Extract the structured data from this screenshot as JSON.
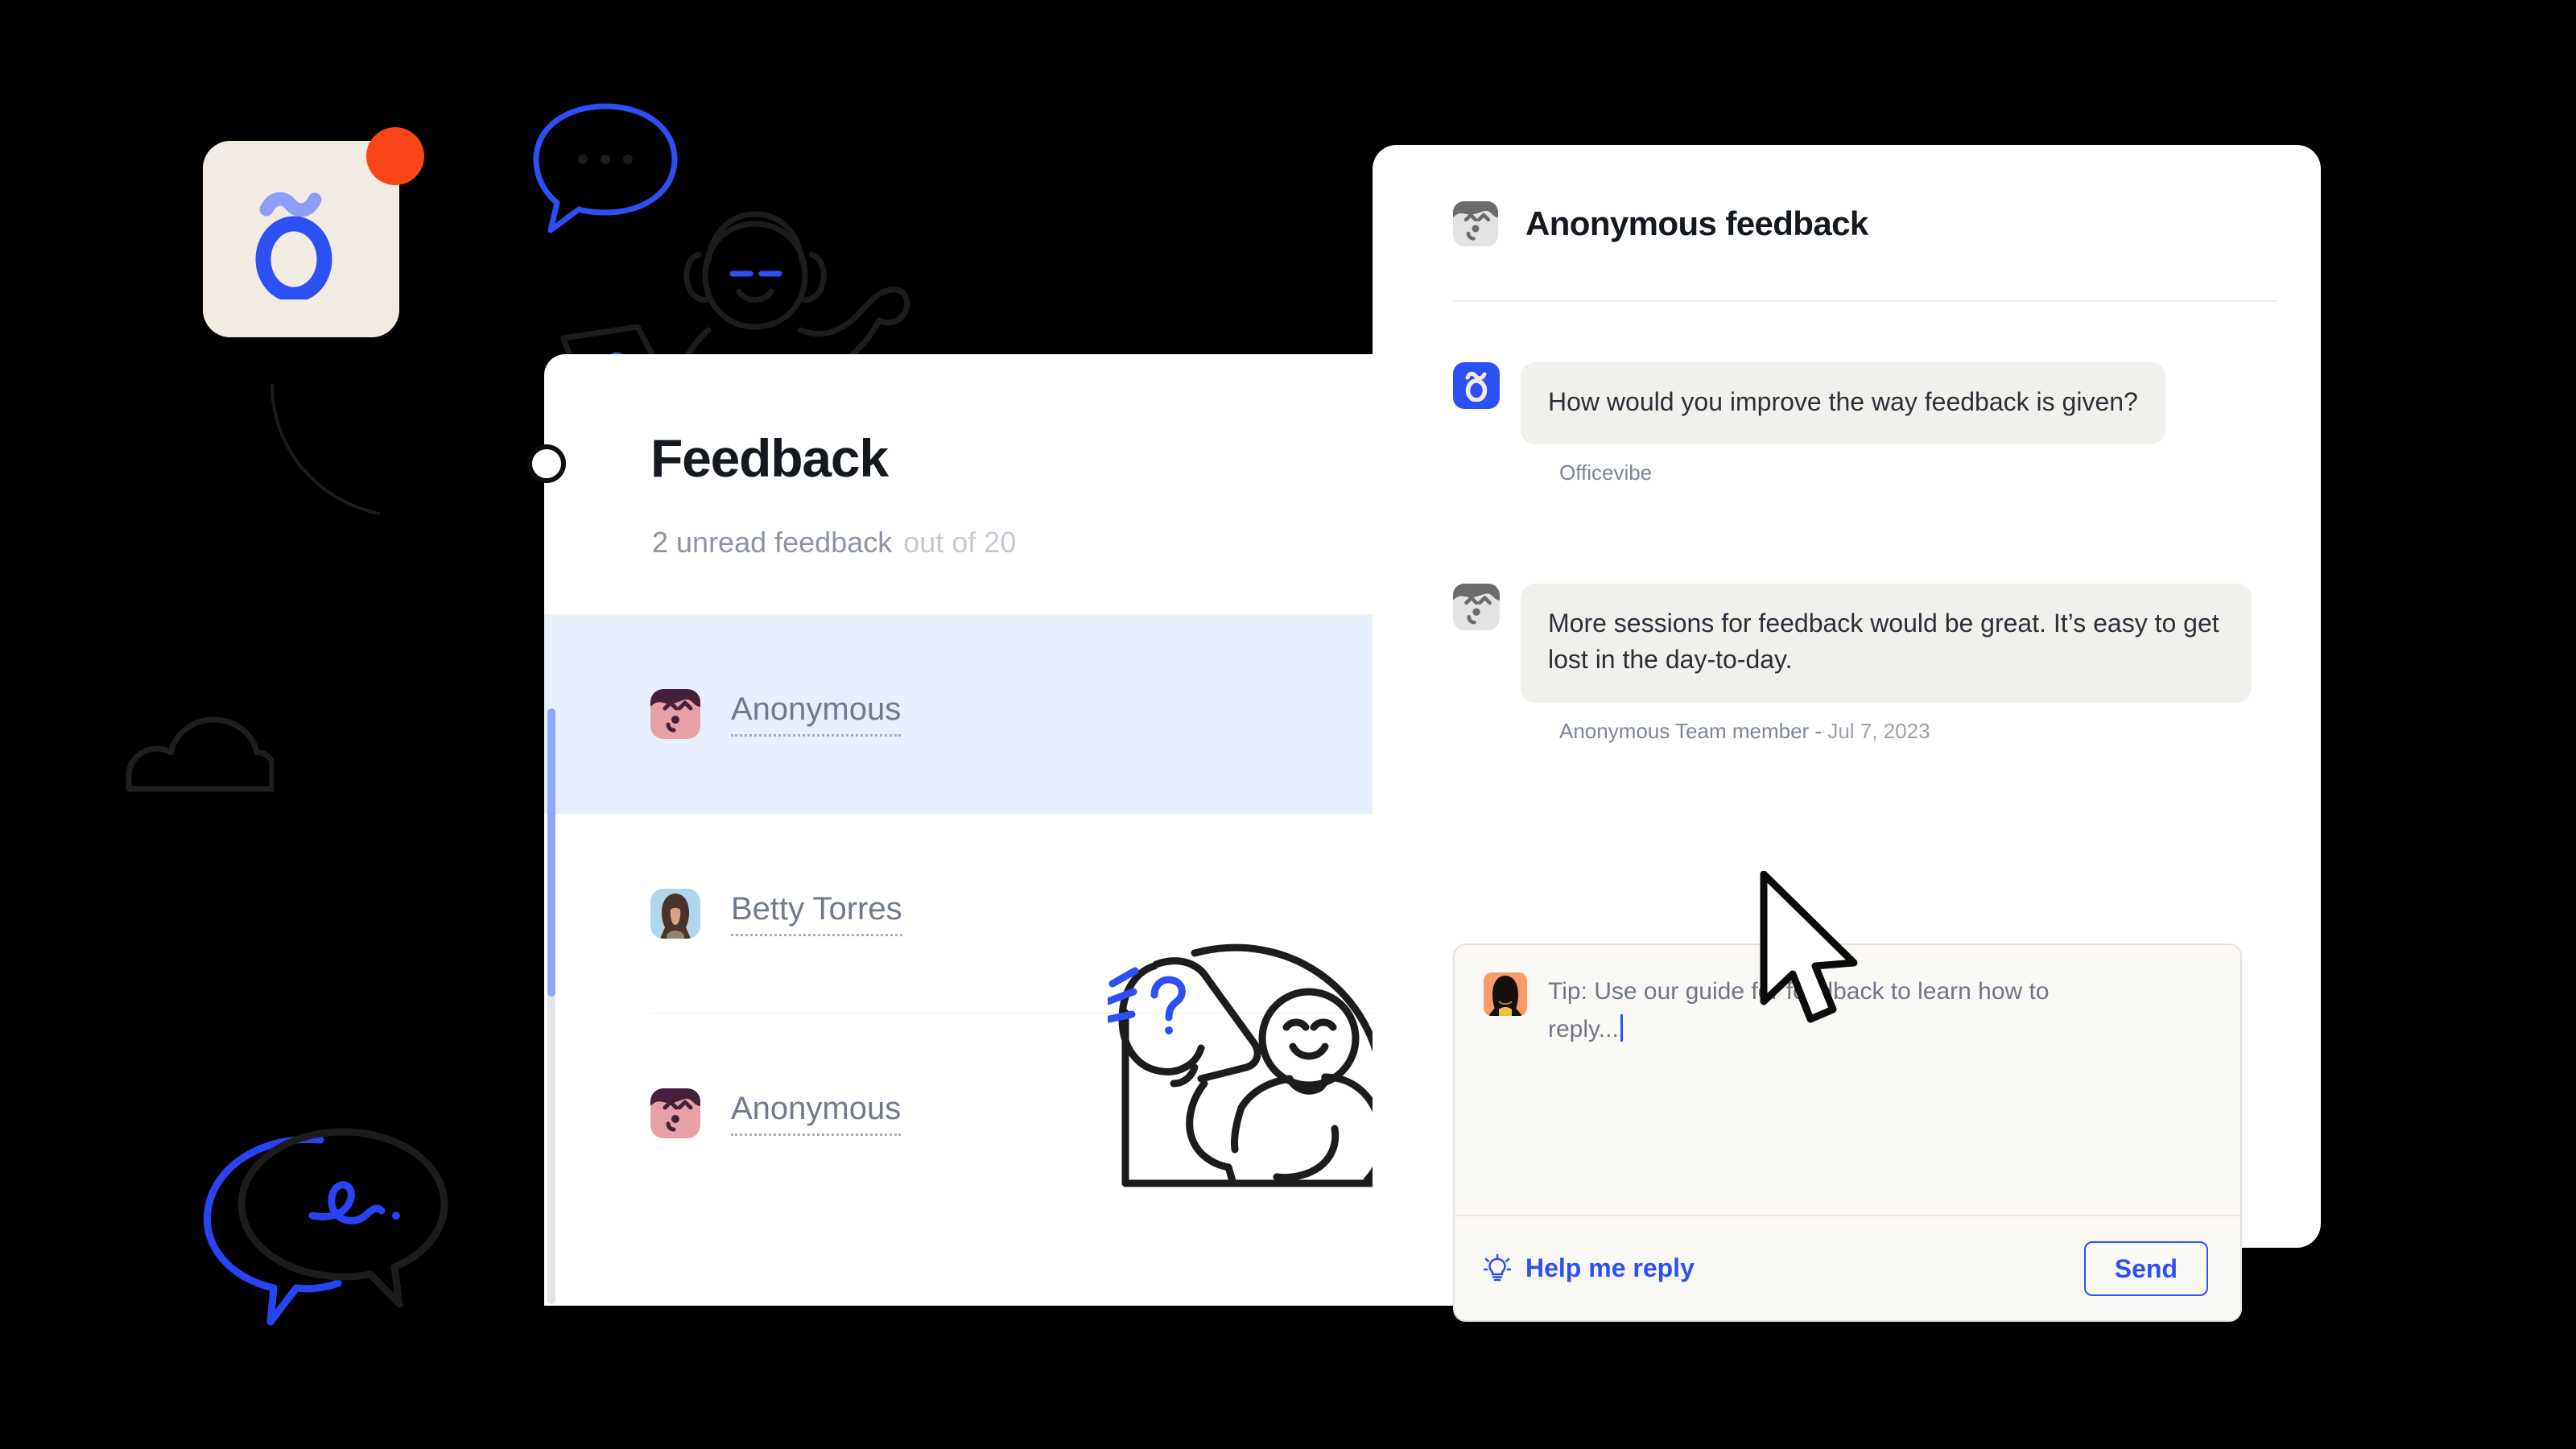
{
  "brand": {
    "logo_glyph": "õ",
    "accent_blue": "#2D50F5",
    "accent_orange": "#FA4616",
    "tile_bg": "#F2EBE4"
  },
  "feedback_panel": {
    "title": "Feedback",
    "unread_text": "2 unread feedback",
    "total_text": "out of 20",
    "rows": [
      {
        "name": "Anonymous",
        "avatar": "anonymous-pink-avatar",
        "selected": true
      },
      {
        "name": "Betty Torres",
        "avatar": "betty-torres-photo",
        "selected": false
      },
      {
        "name": "Anonymous",
        "avatar": "anonymous-pink-avatar",
        "selected": false
      }
    ]
  },
  "chat_panel": {
    "header": {
      "avatar": "anonymous-grey-avatar",
      "title": "Anonymous feedback"
    },
    "messages": [
      {
        "avatar": "officevibe-logo-avatar",
        "text": "How would you improve the way feedback is given?",
        "author": "Officevibe",
        "date": ""
      },
      {
        "avatar": "anonymous-grey-avatar",
        "text": "More sessions for feedback would be great. It’s easy to get lost in the day-to-day.",
        "author": "Anonymous Team member",
        "date": "Jul 7, 2023"
      }
    ],
    "composer": {
      "avatar": "user-photo-avatar",
      "placeholder": "Tip: Use our guide for feedback to learn how to reply...",
      "help_label": "Help me reply",
      "help_icon": "lightbulb-icon",
      "send_label": "Send"
    }
  },
  "decorations": {
    "app_badge": "notification-dot",
    "illustrations": [
      "person-with-laptop-illustration",
      "chat-bubble-dots-illustration",
      "cloud-outline-illustration",
      "speech-bubbles-illustration",
      "megaphone-person-illustration"
    ]
  }
}
